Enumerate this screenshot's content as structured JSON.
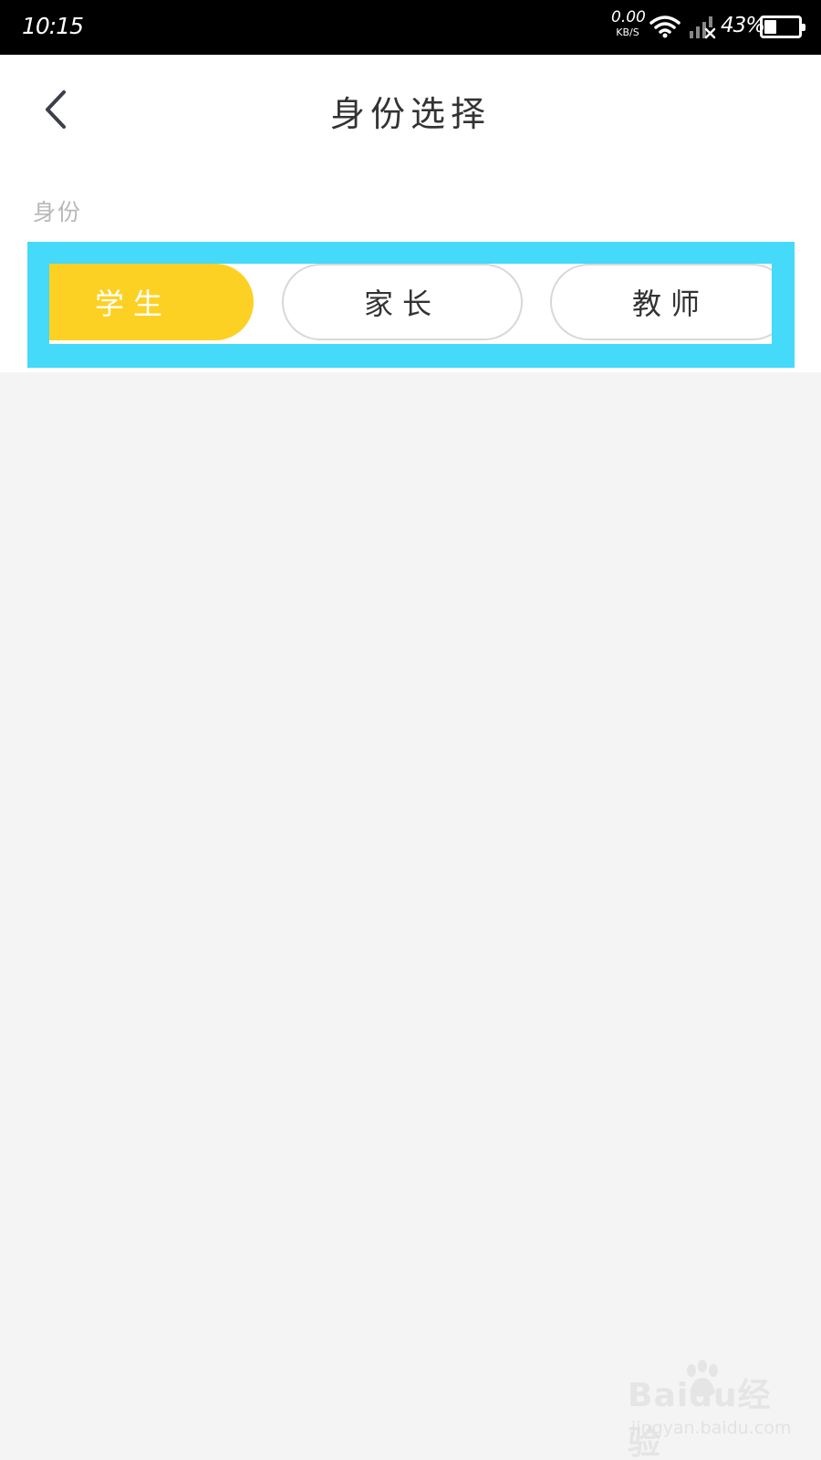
{
  "status_bar": {
    "time": "10:15",
    "net_speed_value": "0.00",
    "net_speed_unit": "KB/S",
    "battery_percent": "43%",
    "battery_level": 0.43
  },
  "header": {
    "title": "身份选择"
  },
  "identity": {
    "section_label": "身份",
    "options": [
      {
        "label": "学生",
        "selected": true
      },
      {
        "label": "家长",
        "selected": false
      },
      {
        "label": "教师",
        "selected": false
      }
    ]
  },
  "colors": {
    "selected_pill": "#fdd123",
    "highlight_frame": "#45d9fa",
    "page_background": "#f4f4f4"
  },
  "watermark": {
    "logo": "Baidu经验",
    "url": "jingyan.baidu.com"
  }
}
